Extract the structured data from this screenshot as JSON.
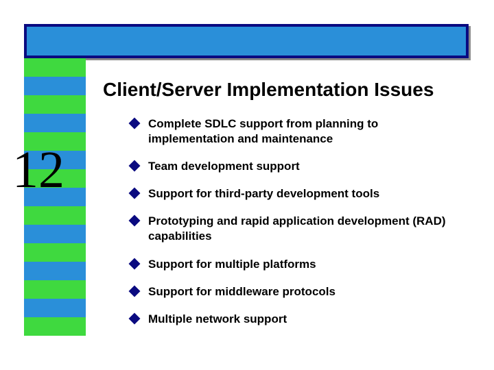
{
  "slide": {
    "title": "Client/Server Implementation Issues",
    "chapter": "12",
    "bullets": [
      "Complete SDLC support from planning to implementation and maintenance",
      "Team development support",
      "Support for third-party development tools",
      "Prototyping and rapid application development (RAD) capabilities",
      "Support for multiple platforms",
      "Support for middleware protocols",
      "Multiple network support"
    ]
  }
}
